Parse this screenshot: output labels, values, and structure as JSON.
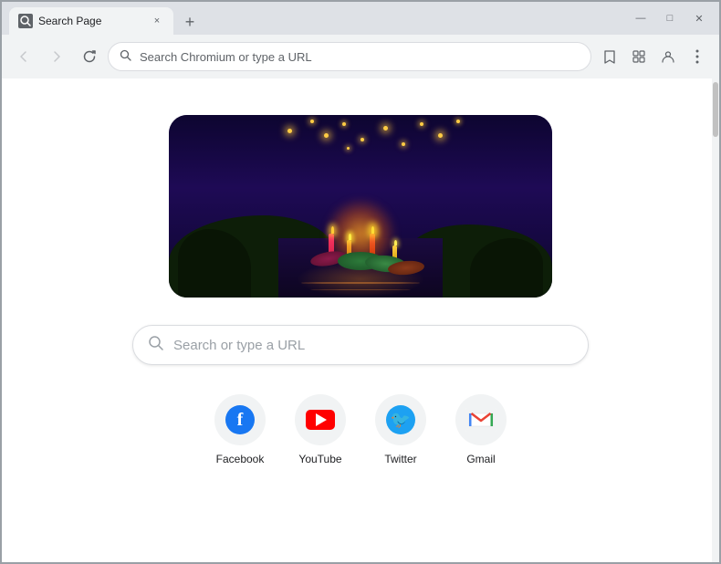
{
  "browser": {
    "tab": {
      "favicon": "🔍",
      "title": "Search Page",
      "close_label": "×"
    },
    "new_tab_label": "+",
    "window_controls": {
      "minimize": "—",
      "maximize": "□",
      "close": "✕"
    },
    "nav": {
      "back_label": "←",
      "forward_label": "→",
      "refresh_label": "↻",
      "address_placeholder": "Search Chromium or type a URL"
    }
  },
  "page": {
    "search_placeholder": "Search or type a URL",
    "shortcuts": [
      {
        "id": "facebook",
        "label": "Facebook"
      },
      {
        "id": "youtube",
        "label": "YouTube"
      },
      {
        "id": "twitter",
        "label": "Twitter"
      },
      {
        "id": "gmail",
        "label": "Gmail"
      }
    ]
  }
}
